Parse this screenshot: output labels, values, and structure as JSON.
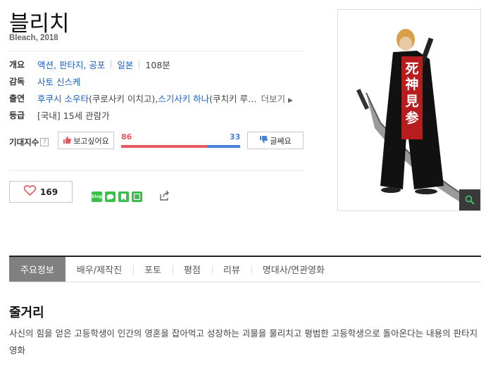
{
  "movie": {
    "title": "블리치",
    "subtitle": "Bleach, 2018"
  },
  "info": {
    "overview_label": "개요",
    "genre": "액션, 판타지, 공포",
    "country": "일본",
    "runtime": "108분",
    "director_label": "감독",
    "director": "사토 신스케",
    "cast_label": "출연",
    "cast1": "후쿠시 소우타",
    "cast1_role": "(쿠로사키 이치고), ",
    "cast2": "스기사키 하나",
    "cast2_role": "(쿠치키 루…",
    "more": "더보기",
    "rating_label": "등급",
    "rating_region": "[국내]",
    "rating": "15세 관람가"
  },
  "expect": {
    "label": "기대지수",
    "help": "?",
    "want_label": "보고싶어요",
    "bad_label": "글쎄요",
    "want_count": "86",
    "bad_count": "33",
    "want_ratio": 0.72
  },
  "like": {
    "count": "169"
  },
  "share_icons": [
    "blog-icon",
    "talk-icon",
    "bookmark-icon",
    "memo-icon"
  ],
  "colors": {
    "positive": "#e8585f",
    "negative": "#4a82d8",
    "accent_green": "#3cbf4a",
    "tab_active": "#808080"
  },
  "tabs": [
    "주요정보",
    "배우/제작진",
    "포토",
    "평점",
    "리뷰",
    "명대사/연관영화"
  ],
  "synopsis": {
    "title": "줄거리",
    "text": "사신의 힘을 얻은 고등학생이 인간의 영혼을 잡아먹고 성장하는 괴물을 물리치고 평범한 고등학생으로 돌아온다는 내용의 판타지 영화"
  },
  "poster": {
    "text": "死神、見参。"
  }
}
